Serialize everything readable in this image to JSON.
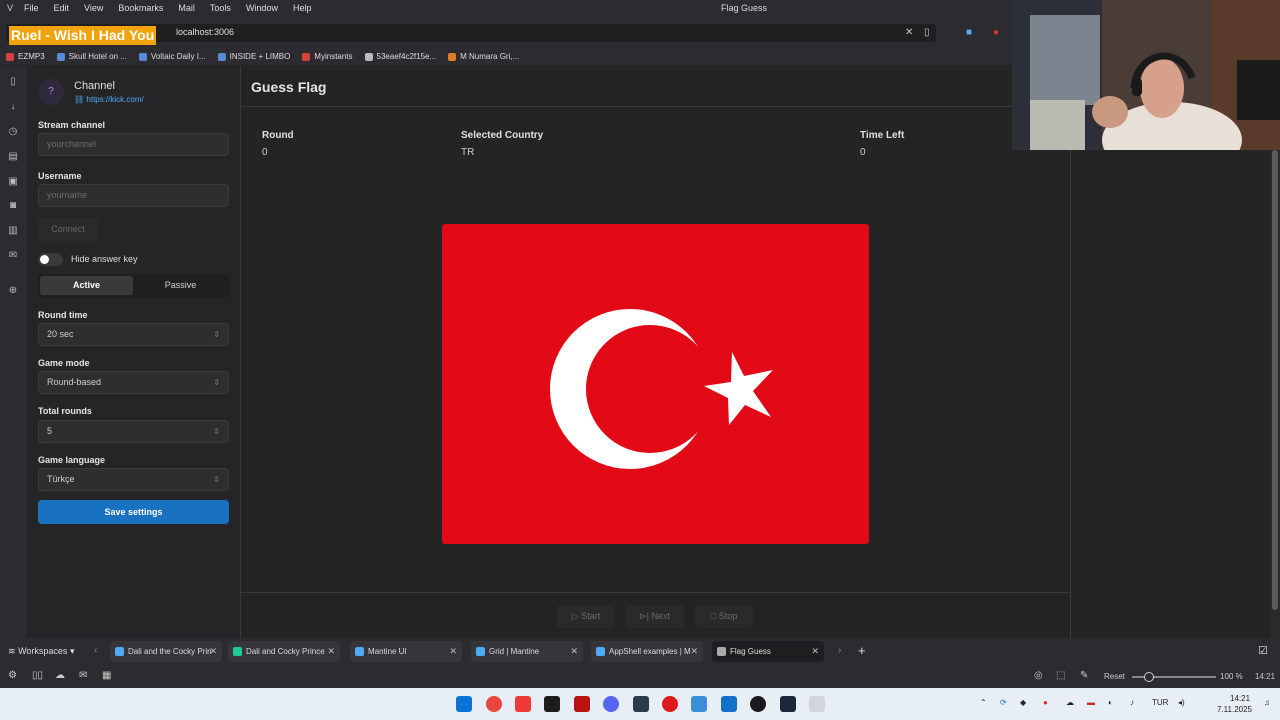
{
  "menubar": {
    "items": [
      "File",
      "Edit",
      "View",
      "Bookmarks",
      "Mail",
      "Tools",
      "Window",
      "Help"
    ],
    "window_title": "Flag Guess"
  },
  "address": {
    "url": "localhost:3006",
    "overlay_title": "Ruel - Wish I Had You"
  },
  "bookmarks": [
    {
      "label": "EZMP3",
      "color": "#d94141"
    },
    {
      "label": "Skull Hotel on ...",
      "color": "#5a8ad6"
    },
    {
      "label": "Voltaic Daily I...",
      "color": "#5a8ad6"
    },
    {
      "label": "INSIDE + LIMBO",
      "color": "#5a8ad6"
    },
    {
      "label": "Myinstants",
      "color": "#d94141"
    },
    {
      "label": "53eaef4c2f15e...",
      "color": "#bbbbbb"
    },
    {
      "label": "M Numara Gri,...",
      "color": "#e07a28"
    }
  ],
  "navbar": {
    "avatar": "?",
    "title": "Channel",
    "link": "https://kick.com/",
    "stream_channel": {
      "label": "Stream channel",
      "placeholder": "yourchannel"
    },
    "username": {
      "label": "Username",
      "placeholder": "yourname"
    },
    "connect": "Connect",
    "hide_answer": "Hide answer key",
    "hide_answer_on": false,
    "mode_tabs": {
      "active": "Active",
      "passive": "Passive"
    },
    "round_time": {
      "label": "Round time",
      "value": "20 sec"
    },
    "game_mode": {
      "label": "Game mode",
      "value": "Round-based"
    },
    "total_rounds": {
      "label": "Total rounds",
      "value": "5"
    },
    "game_language": {
      "label": "Game language",
      "value": "Türkçe"
    },
    "save": "Save settings"
  },
  "main": {
    "title": "Guess Flag",
    "stats": [
      {
        "label": "Round",
        "value": "0"
      },
      {
        "label": "Selected Country",
        "value": "TR"
      },
      {
        "label": "Time Left",
        "value": "0"
      }
    ],
    "flag": {
      "country": "TR",
      "background": "#e30a17",
      "emblem": "#ffffff"
    },
    "controls": {
      "start": "Start",
      "next": "Next",
      "stop": "Stop"
    }
  },
  "tabbar": {
    "workspaces": "Workspaces",
    "tabs": [
      {
        "label": "Dali and the Cocky Prin",
        "color": "#4dabf7",
        "active": false
      },
      {
        "label": "Dali and Cocky Prince",
        "color": "#20c997",
        "active": false
      },
      {
        "label": "Mantine UI",
        "color": "#4dabf7",
        "active": false
      },
      {
        "label": "Grid | Mantine",
        "color": "#4dabf7",
        "active": false
      },
      {
        "label": "AppShell examples | M",
        "color": "#4dabf7",
        "active": false
      },
      {
        "label": "Flag Guess",
        "color": "#aaaaaa",
        "active": true
      }
    ]
  },
  "statusbar": {
    "reset": "Reset",
    "zoom": "100 %",
    "time": "14:21"
  },
  "taskbar": {
    "lang": "TUR",
    "time": "14:21",
    "date": "7.11.2025"
  }
}
